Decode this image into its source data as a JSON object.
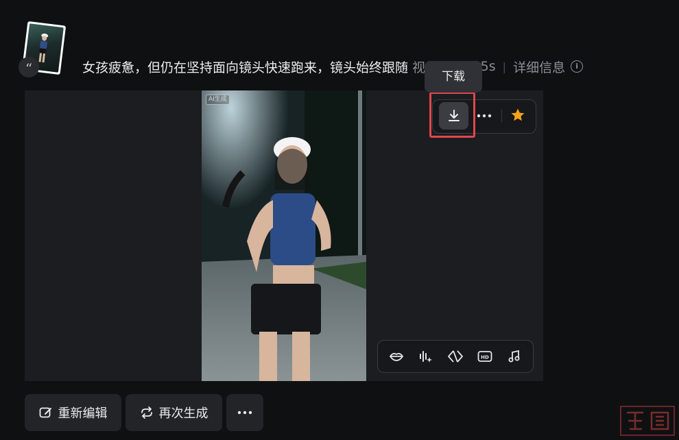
{
  "prompt": {
    "text": "女孩疲惫，但仍在坚持面向镜头快速跑来，镜头始终跟随",
    "model": "视频 3.0",
    "duration": "5s",
    "details_label": "详细信息"
  },
  "video": {
    "ai_badge": "AI生成"
  },
  "toolbar": {
    "download_tooltip": "下载",
    "star_color": "#f7a21b"
  },
  "tools": [
    "lip-sync-icon",
    "sparkle-audio-icon",
    "frame-interpolate-icon",
    "hd-icon",
    "music-icon"
  ],
  "actions": {
    "reedit_label": "重新编辑",
    "regenerate_label": "再次生成"
  },
  "watermark": {
    "text": "猫鼠"
  }
}
